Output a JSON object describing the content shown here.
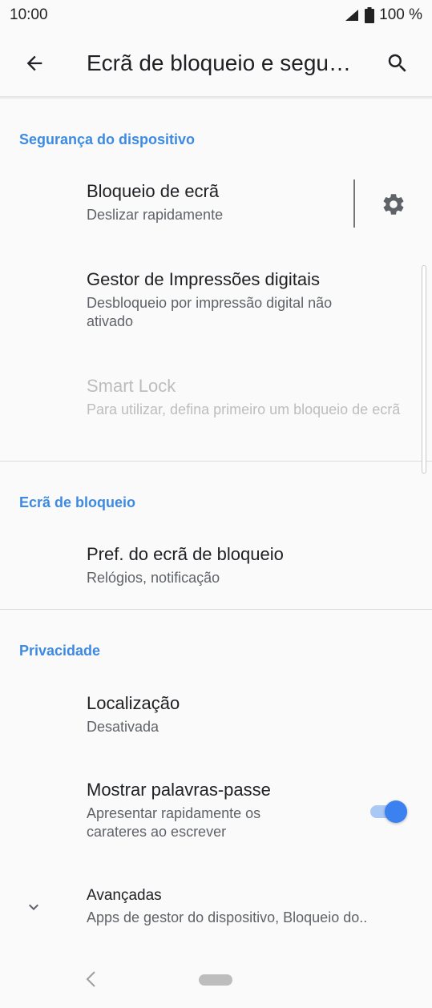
{
  "status": {
    "time": "10:00",
    "battery": "100 %"
  },
  "appbar": {
    "title": "Ecrã de bloqueio e segu…"
  },
  "sections": {
    "device_security": {
      "header": "Segurança do dispositivo",
      "items": [
        {
          "title": "Bloqueio de ecrã",
          "subtitle": "Deslizar rapidamente"
        },
        {
          "title": "Gestor de Impressões digitais",
          "subtitle": "Desbloqueio por impressão digital não ativado"
        },
        {
          "title": "Smart Lock",
          "subtitle": "Para utilizar, defina primeiro um bloqueio de ecrã"
        }
      ]
    },
    "lock_screen": {
      "header": "Ecrã de bloqueio",
      "items": [
        {
          "title": "Pref. do ecrã de bloqueio",
          "subtitle": "Relógios, notificação"
        }
      ]
    },
    "privacy": {
      "header": "Privacidade",
      "items": [
        {
          "title": "Localização",
          "subtitle": "Desativada"
        },
        {
          "title": "Mostrar palavras-passe",
          "subtitle": "Apresentar rapidamente os carateres ao escrever",
          "toggle_on": true
        },
        {
          "title": "Avançadas",
          "subtitle": "Apps de gestor do dispositivo, Bloqueio do.."
        }
      ]
    }
  },
  "colors": {
    "accent": "#3d8ae3",
    "toggle_thumb": "#3b82f0",
    "toggle_track": "#a9c8f5"
  }
}
